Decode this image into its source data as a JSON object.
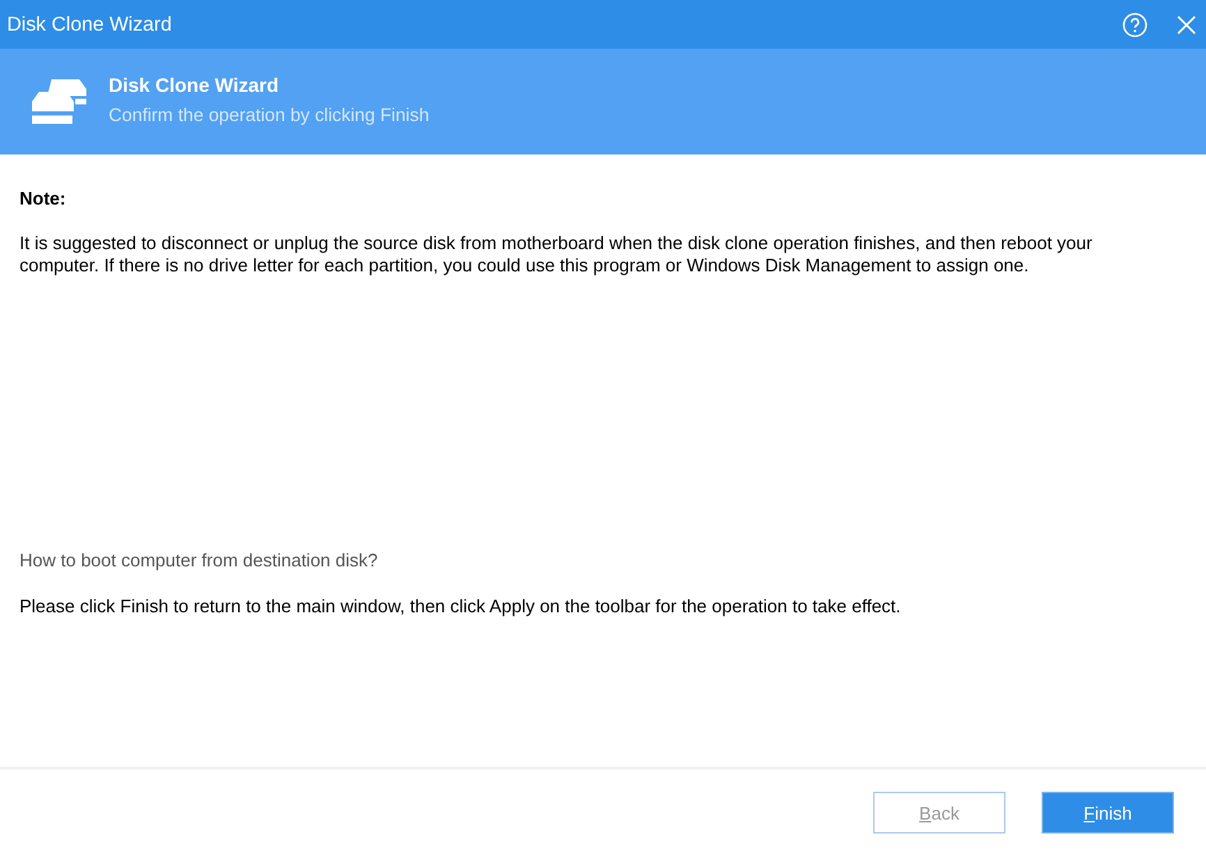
{
  "window": {
    "title": "Disk Clone Wizard"
  },
  "header": {
    "title": "Disk Clone Wizard",
    "subtitle": "Confirm the operation by clicking Finish"
  },
  "content": {
    "note_heading": "Note:",
    "note_text": "It is suggested to disconnect or unplug the source disk from motherboard when the disk clone operation finishes, and then reboot your computer. If there is no drive letter for each partition, you could use this program or Windows Disk Management to assign one.",
    "help_link": "How to boot computer from destination disk?",
    "instruction": "Please click Finish to return to the main window, then click Apply on the toolbar for the operation to take effect."
  },
  "buttons": [
    {
      "kind": "secondary",
      "disabled": true,
      "label_parts": [
        {
          "text": "B",
          "underlined": true
        },
        {
          "text": "ack",
          "underlined": false
        }
      ]
    },
    {
      "kind": "primary",
      "disabled": false,
      "label_parts": [
        {
          "text": "F",
          "underlined": true
        },
        {
          "text": "inish",
          "underlined": false
        }
      ]
    }
  ]
}
